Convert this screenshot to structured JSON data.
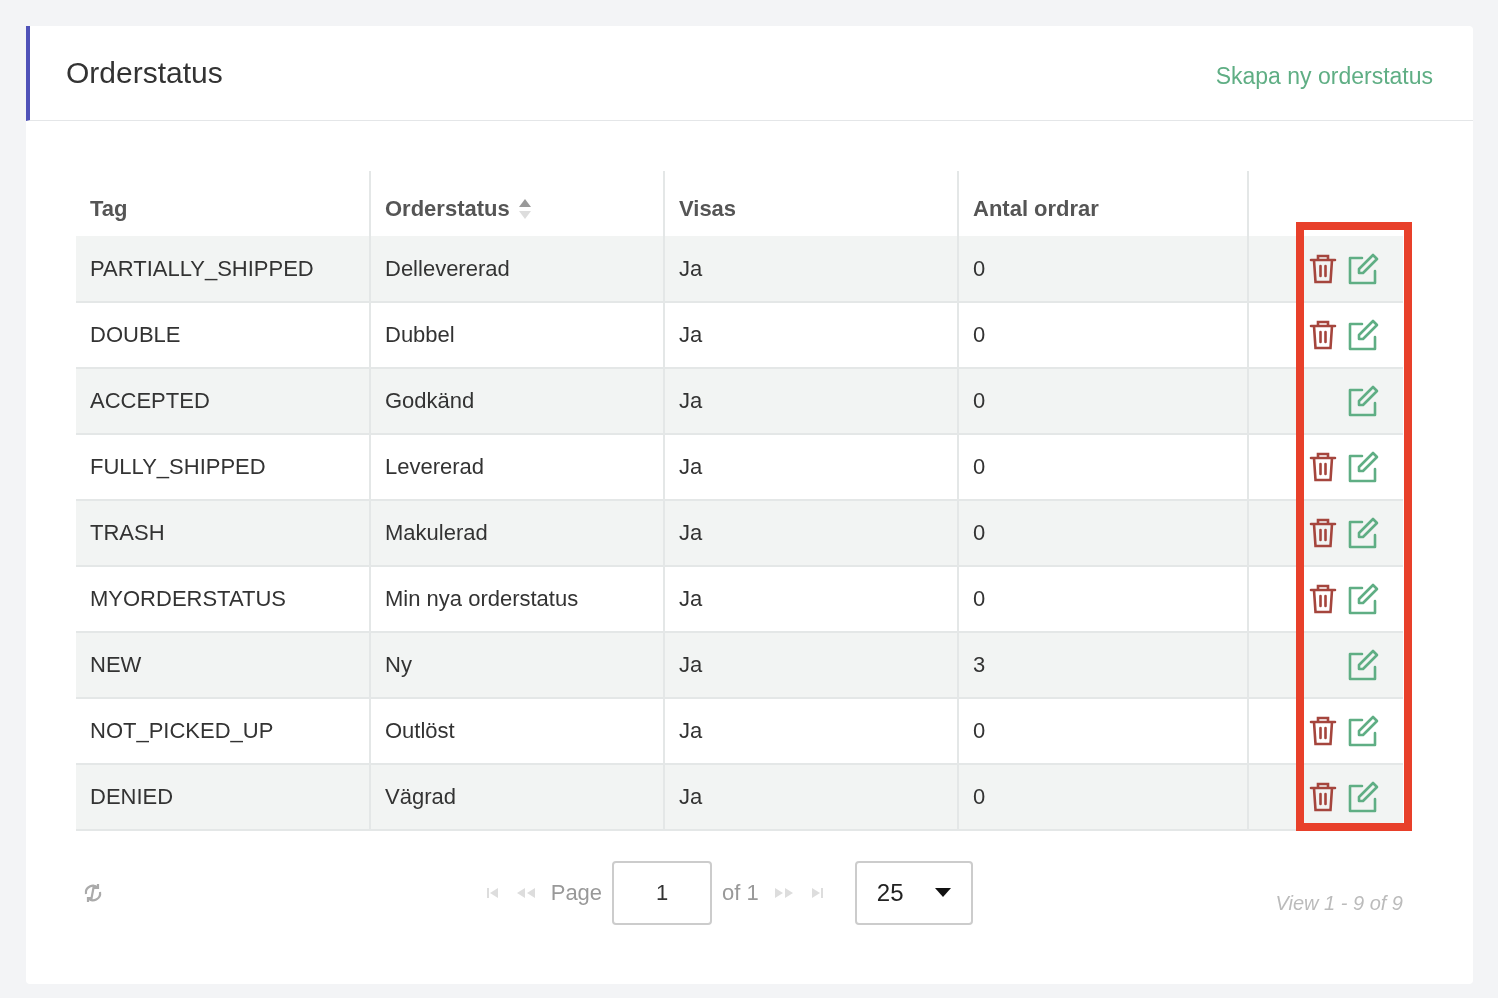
{
  "header": {
    "title": "Orderstatus",
    "action": "Skapa ny orderstatus"
  },
  "table": {
    "columns": [
      {
        "label": "Tag",
        "sortable": false
      },
      {
        "label": "Orderstatus",
        "sortable": true
      },
      {
        "label": "Visas",
        "sortable": false
      },
      {
        "label": "Antal ordrar",
        "sortable": false
      }
    ],
    "rows": [
      {
        "tag": "PARTIALLY_SHIPPED",
        "status": "Dellevererad",
        "shown": "Ja",
        "orders": "0",
        "deletable": true
      },
      {
        "tag": "DOUBLE",
        "status": "Dubbel",
        "shown": "Ja",
        "orders": "0",
        "deletable": true
      },
      {
        "tag": "ACCEPTED",
        "status": "Godkänd",
        "shown": "Ja",
        "orders": "0",
        "deletable": false
      },
      {
        "tag": "FULLY_SHIPPED",
        "status": "Levererad",
        "shown": "Ja",
        "orders": "0",
        "deletable": true
      },
      {
        "tag": "TRASH",
        "status": "Makulerad",
        "shown": "Ja",
        "orders": "0",
        "deletable": true
      },
      {
        "tag": "MYORDERSTATUS",
        "status": "Min nya orderstatus",
        "shown": "Ja",
        "orders": "0",
        "deletable": true
      },
      {
        "tag": "NEW",
        "status": "Ny",
        "shown": "Ja",
        "orders": "3",
        "deletable": false
      },
      {
        "tag": "NOT_PICKED_UP",
        "status": "Outlöst",
        "shown": "Ja",
        "orders": "0",
        "deletable": true
      },
      {
        "tag": "DENIED",
        "status": "Vägrad",
        "shown": "Ja",
        "orders": "0",
        "deletable": true
      }
    ]
  },
  "pager": {
    "page_label": "Page",
    "page": "1",
    "of_label": "of 1",
    "page_size": "25",
    "summary": "View 1 - 9 of 9"
  }
}
